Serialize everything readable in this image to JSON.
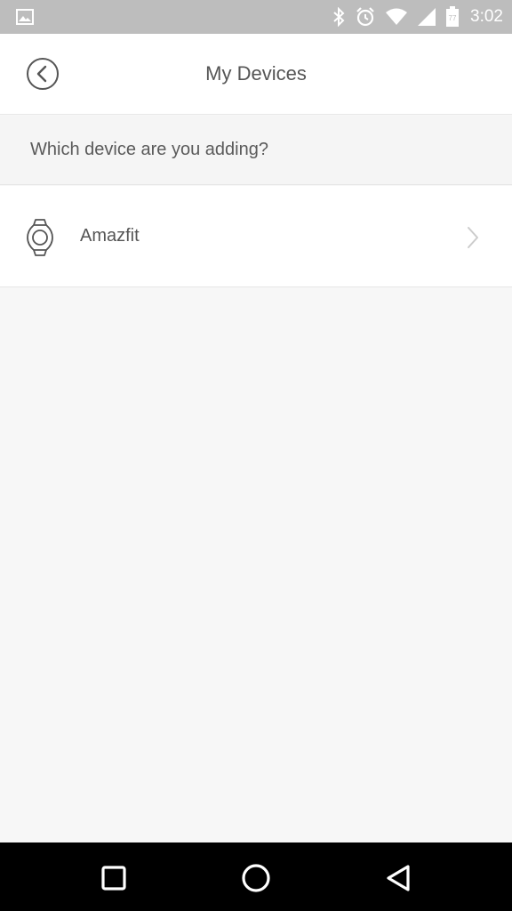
{
  "status_bar": {
    "time": "3:02",
    "battery_level": "77",
    "icons": [
      "image-icon",
      "bluetooth-icon",
      "alarm-icon",
      "wifi-icon",
      "cell-signal-icon",
      "battery-icon"
    ]
  },
  "app_bar": {
    "title": "My Devices",
    "back_icon": "back-circle-icon"
  },
  "section": {
    "prompt": "Which device are you adding?"
  },
  "devices": [
    {
      "label": "Amazfit",
      "icon": "watch-icon"
    }
  ],
  "nav_bar": {
    "icons": [
      "recents-square-icon",
      "home-circle-icon",
      "back-triangle-icon"
    ]
  },
  "colors": {
    "status_bar": "#bdbdbd",
    "background": "#f7f7f7",
    "text": "#555555",
    "nav_bar": "#000000"
  }
}
